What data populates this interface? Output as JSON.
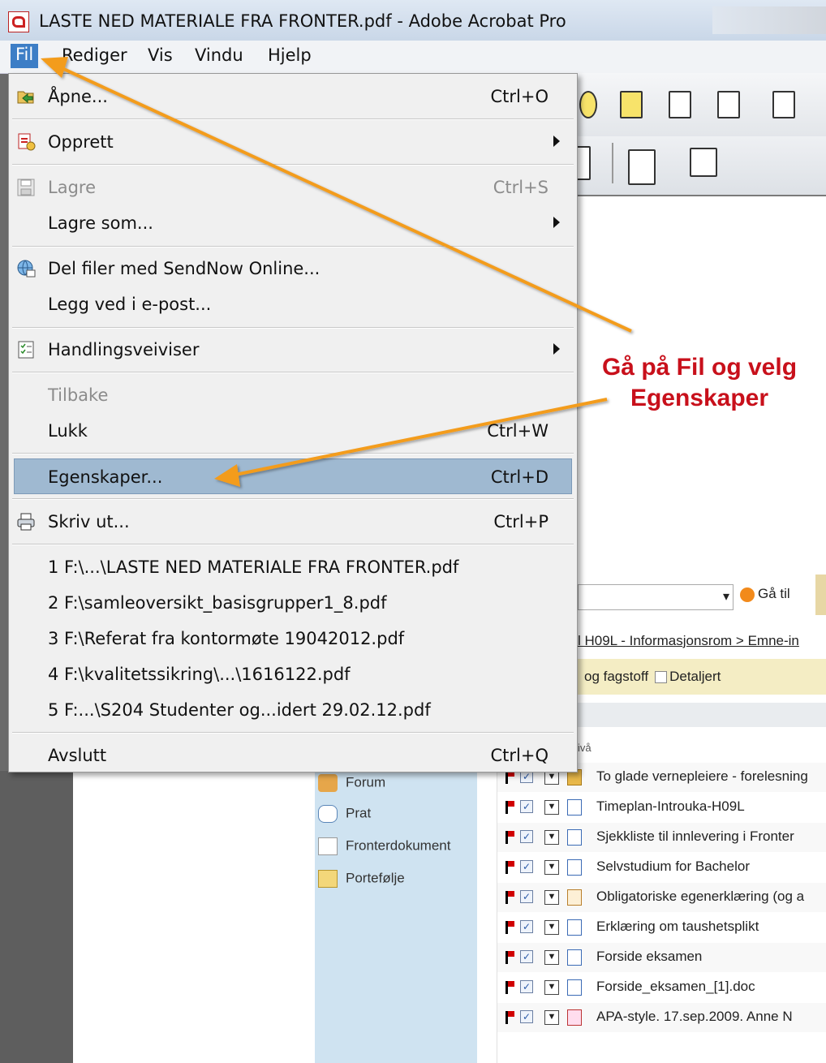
{
  "window": {
    "title": "LASTE NED MATERIALE FRA FRONTER.pdf - Adobe Acrobat Pro"
  },
  "menubar": {
    "items": [
      "Fil",
      "Rediger",
      "Vis",
      "Vindu",
      "Hjelp"
    ]
  },
  "file_menu": {
    "items": [
      {
        "label": "Åpne...",
        "shortcut": "Ctrl+O",
        "icon": "open-folder-icon"
      },
      {
        "label": "Opprett",
        "submenu": true,
        "icon": "create-pdf-icon"
      },
      {
        "label": "Lagre",
        "shortcut": "Ctrl+S",
        "disabled": true,
        "icon": "save-disk-icon"
      },
      {
        "label": "Lagre som...",
        "submenu": true
      },
      {
        "label": "Del filer med SendNow Online...",
        "icon": "sendnow-globe-icon"
      },
      {
        "label": "Legg ved i e-post..."
      },
      {
        "label": "Handlingsveiviser",
        "submenu": true,
        "icon": "checklist-icon"
      },
      {
        "label": "Tilbake",
        "disabled": true
      },
      {
        "label": "Lukk",
        "shortcut": "Ctrl+W"
      },
      {
        "label": "Egenskaper...",
        "shortcut": "Ctrl+D",
        "highlighted": true
      },
      {
        "label": "Skriv ut...",
        "shortcut": "Ctrl+P",
        "icon": "printer-icon"
      },
      {
        "label": "1 F:\\...\\LASTE NED MATERIALE FRA FRONTER.pdf"
      },
      {
        "label": "2 F:\\samleoversikt_basisgrupper1_8.pdf"
      },
      {
        "label": "3 F:\\Referat fra kontormøte 19042012.pdf"
      },
      {
        "label": "4 F:\\kvalitetssikring\\...\\1616122.pdf"
      },
      {
        "label": "5 F:...\\S204 Studenter og...idert 29.02.12.pdf"
      },
      {
        "label": "Avslutt",
        "shortcut": "Ctrl+Q"
      }
    ]
  },
  "annotation": {
    "line1": "Gå på Fil og velg",
    "line2": "Egenskaper"
  },
  "fronter": {
    "goto_label": "Gå til",
    "breadcrumb": "l H09L - Informasjonsrom > Emne-in",
    "folder_text": "og fagstoff",
    "detail_label": "Detaljert",
    "level_header": "ivå",
    "nav": [
      "Forum",
      "Prat",
      "Fronterdokument",
      "Portefølje"
    ],
    "rows": [
      {
        "text": "To glade vernepleiere - forelesning",
        "type": "folder"
      },
      {
        "text": "Timeplan-Introuka-H09L",
        "type": "doc"
      },
      {
        "text": "Sjekkliste til innlevering i Fronter",
        "type": "doc"
      },
      {
        "text": "Selvstudium for Bachelor",
        "type": "doc"
      },
      {
        "text": "Obligatoriske egenerklæring (og a",
        "type": "mix"
      },
      {
        "text": "Erklæring om taushetsplikt",
        "type": "doc"
      },
      {
        "text": "Forside eksamen",
        "type": "doc"
      },
      {
        "text": "Forside_eksamen_[1].doc",
        "type": "doc"
      },
      {
        "text": "APA-style. 17.sep.2009. Anne N",
        "type": "pdf"
      }
    ]
  },
  "colors": {
    "accent_orange": "#f39c1f",
    "annotation_red": "#c8101b",
    "menu_highlight": "#9fb9d1",
    "menubar_active": "#3d7ec6"
  }
}
